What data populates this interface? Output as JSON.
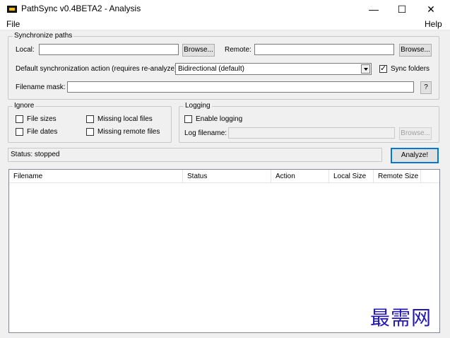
{
  "window": {
    "title": "PathSync v0.4BETA2 - Analysis",
    "minimize": "—",
    "maximize": "☐",
    "close": "✕",
    "icon": "app-icon"
  },
  "menu": {
    "file": "File",
    "help": "Help"
  },
  "sync_paths": {
    "title": "Synchronize paths",
    "local_label": "Local:",
    "local_value": "",
    "browse_local": "Browse...",
    "remote_label": "Remote:",
    "remote_value": "",
    "browse_remote": "Browse...",
    "default_action_label": "Default synchronization action (requires re-analyze):",
    "default_action_value": "Bidirectional (default)",
    "sync_folders_label": "Sync folders",
    "sync_folders_checked": true,
    "filename_mask_label": "Filename mask:",
    "filename_mask_value": "",
    "help_button": "?"
  },
  "ignore": {
    "title": "Ignore",
    "file_sizes": "File sizes",
    "file_dates": "File dates",
    "missing_local": "Missing local files",
    "missing_remote": "Missing remote files"
  },
  "logging": {
    "title": "Logging",
    "enable_logging": "Enable logging",
    "log_filename_label": "Log filename:",
    "log_filename_value": "",
    "browse_log": "Browse..."
  },
  "status": {
    "text": "Status: stopped",
    "analyze_button": "Analyze!"
  },
  "list": {
    "columns": [
      "Filename",
      "Status",
      "Action",
      "Local Size",
      "Remote Size"
    ]
  },
  "watermark": "最需网"
}
